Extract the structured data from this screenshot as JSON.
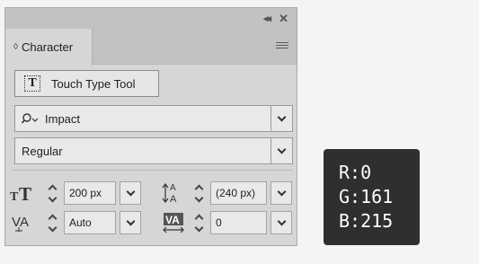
{
  "panel": {
    "tab_label": "Character",
    "touch_type_label": "Touch Type Tool",
    "font_family": "Impact",
    "font_style": "Regular",
    "font_size": "200 px",
    "leading": "(240 px)",
    "kerning": "Auto",
    "tracking": "0"
  },
  "color_readout": {
    "r": "R:0",
    "g": "G:161",
    "b": "B:215"
  },
  "icons": [
    "collapse-icon",
    "close-icon",
    "panel-menu-icon",
    "touch-type-icon",
    "search-icon",
    "font-size-icon",
    "leading-icon",
    "kerning-icon",
    "tracking-icon"
  ]
}
